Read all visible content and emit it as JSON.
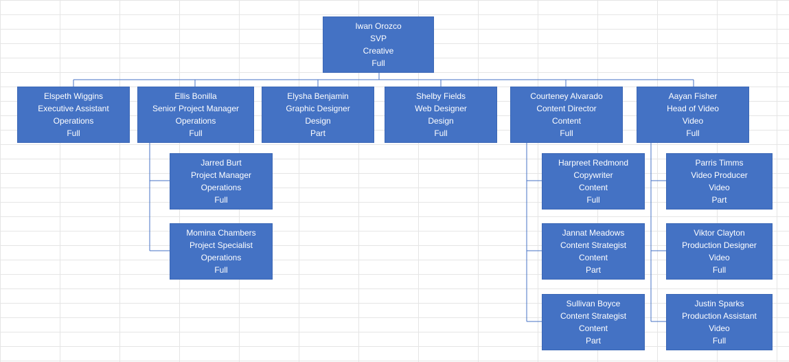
{
  "colors": {
    "node_fill": "#4472c4",
    "node_text": "#ffffff",
    "connector": "#4472c4"
  },
  "org": {
    "root": {
      "name": "Iwan Orozco",
      "title": "SVP",
      "dept": "Creative",
      "status": "Full"
    },
    "l2": {
      "elspeth": {
        "name": "Elspeth Wiggins",
        "title": "Executive Assistant",
        "dept": "Operations",
        "status": "Full"
      },
      "ellis": {
        "name": "Ellis Bonilla",
        "title": "Senior Project Manager",
        "dept": "Operations",
        "status": "Full"
      },
      "elysha": {
        "name": "Elysha Benjamin",
        "title": "Graphic Designer",
        "dept": "Design",
        "status": "Part"
      },
      "shelby": {
        "name": "Shelby Fields",
        "title": "Web Designer",
        "dept": "Design",
        "status": "Full"
      },
      "court": {
        "name": "Courteney Alvarado",
        "title": "Content Director",
        "dept": "Content",
        "status": "Full"
      },
      "aayan": {
        "name": "Aayan Fisher",
        "title": "Head of Video",
        "dept": "Video",
        "status": "Full"
      }
    },
    "l3": {
      "jarred": {
        "name": "Jarred Burt",
        "title": "Project Manager",
        "dept": "Operations",
        "status": "Full"
      },
      "momina": {
        "name": "Momina Chambers",
        "title": "Project Specialist",
        "dept": "Operations",
        "status": "Full"
      },
      "harpreet": {
        "name": "Harpreet Redmond",
        "title": "Copywriter",
        "dept": "Content",
        "status": "Full"
      },
      "jannat": {
        "name": "Jannat Meadows",
        "title": "Content Strategist",
        "dept": "Content",
        "status": "Part"
      },
      "sullivan": {
        "name": "Sullivan Boyce",
        "title": "Content Strategist",
        "dept": "Content",
        "status": "Part"
      },
      "parris": {
        "name": "Parris Timms",
        "title": "Video Producer",
        "dept": "Video",
        "status": "Part"
      },
      "viktor": {
        "name": "Viktor Clayton",
        "title": "Production Designer",
        "dept": "Video",
        "status": "Full"
      },
      "justin": {
        "name": "Justin Sparks",
        "title": "Production Assistant",
        "dept": "Video",
        "status": "Full"
      }
    }
  }
}
